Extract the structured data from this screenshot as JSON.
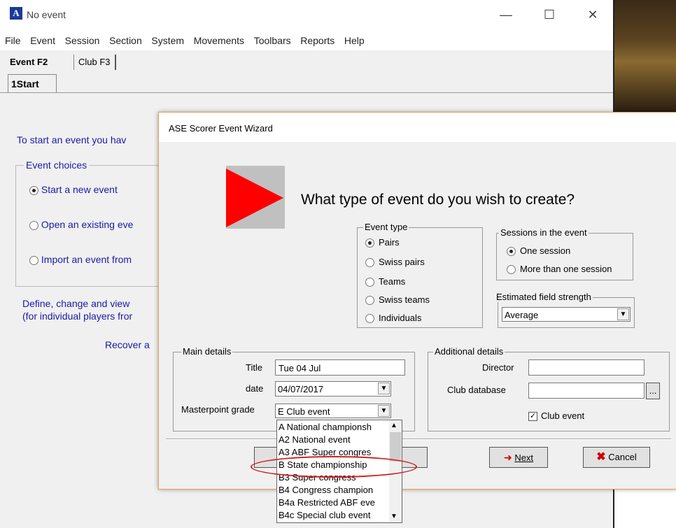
{
  "app": {
    "title": "No event",
    "icon_letter": "A",
    "min_label": "—",
    "max_label": "☐",
    "close_label": "✕"
  },
  "menu": [
    "File",
    "Event",
    "Session",
    "Section",
    "System",
    "Movements",
    "Toolbars",
    "Reports",
    "Help"
  ],
  "tabs": {
    "event": "Event F2",
    "club": "Club F3"
  },
  "subtab": "1Start",
  "background_text": {
    "intro": "To start an event you hav",
    "event_choices_legend": "Event choices",
    "choices": [
      "Start a new event",
      "Open an existing eve",
      "Import an event from"
    ],
    "define_line1": "Define, change and view",
    "define_line2": "(for individual players fror",
    "recover": "Recover a"
  },
  "dialog": {
    "title": "ASE Scorer Event Wizard",
    "question": "What type of event do you wish to create?",
    "event_type": {
      "legend": "Event type",
      "options": [
        "Pairs",
        "Swiss pairs",
        "Teams",
        "Swiss teams",
        "Individuals"
      ],
      "selected": "Pairs"
    },
    "sessions": {
      "legend": "Sessions in the event",
      "options": [
        "One session",
        "More than one session"
      ],
      "selected": "One session"
    },
    "field_strength": {
      "legend": "Estimated field strength",
      "value": "Average"
    },
    "main_details": {
      "legend": "Main details",
      "title_label": "Title",
      "title_value": "Tue 04 Jul",
      "date_label": "date",
      "date_value": "04/07/2017",
      "grade_label": "Masterpoint grade",
      "grade_value": "E  Club event"
    },
    "additional_details": {
      "legend": "Additional details",
      "director_label": "Director",
      "director_value": "",
      "club_db_label": "Club database",
      "club_db_value": "",
      "browse_label": "...",
      "club_event_label": "Club event",
      "club_event_checked": true
    },
    "buttons": {
      "next": "Next",
      "cancel": "Cancel"
    },
    "grade_options": [
      "A   National championsh",
      "A2  National event",
      "A3  ABF Super congres",
      "B   State championship",
      "B3  Super congress",
      "B4  Congress champion",
      "B4a Restricted ABF eve",
      "B4c Special club event"
    ],
    "highlighted_option": "B   State championship"
  },
  "colors": {
    "accent_blue": "#1a1aa8",
    "annotation_red": "#d02020",
    "play_red": "#ff0000"
  }
}
